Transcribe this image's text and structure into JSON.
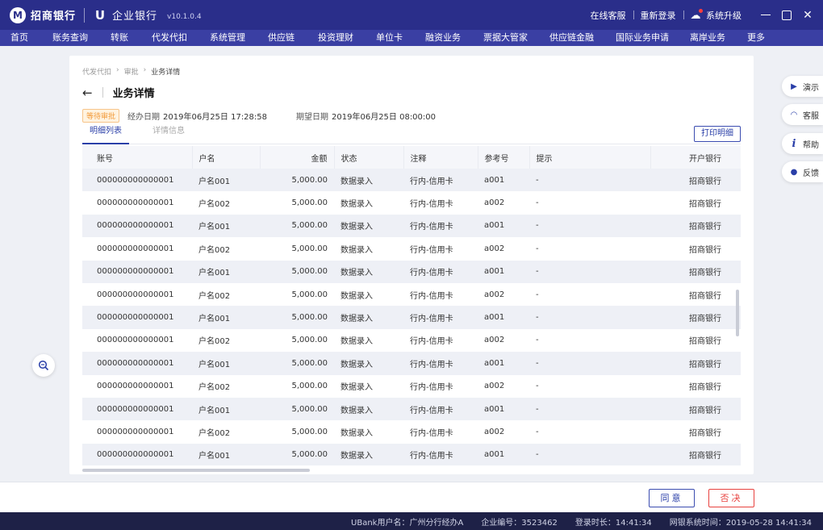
{
  "header": {
    "bank_logo_char": "M",
    "bank_name": "招商银行",
    "enterprise_logo_char": "U",
    "product_name": "企业银行",
    "version": "v10.1.0.4",
    "links": [
      "在线客服",
      "重新登录"
    ],
    "upgrade_label": "系统升级"
  },
  "nav": {
    "items": [
      "首页",
      "账务查询",
      "转账",
      "代发代扣",
      "系统管理",
      "供应链",
      "投资理财",
      "单位卡",
      "融资业务",
      "票据大管家",
      "供应链金融",
      "国际业务申请",
      "离岸业务",
      "更多"
    ]
  },
  "breadcrumb": [
    "代发代扣",
    "审批",
    "业务详情"
  ],
  "page": {
    "back_icon": "←",
    "title": "业务详情",
    "status_badge": "等待审批",
    "handle_date_label": "经办日期",
    "handle_date": "2019年06月25日 17:28:58",
    "expect_date_label": "期望日期",
    "expect_date": "2019年06月25日 08:00:00",
    "tabs": [
      "明细列表",
      "详情信息"
    ],
    "print_label": "打印明细"
  },
  "table": {
    "columns": [
      "账号",
      "户名",
      "金额",
      "状态",
      "注释",
      "参考号",
      "提示",
      "开户银行"
    ],
    "rows": [
      [
        "000000000000001",
        "户名001",
        "5,000.00",
        "数据录入",
        "行内-信用卡",
        "a001",
        "-",
        "招商银行"
      ],
      [
        "000000000000001",
        "户名002",
        "5,000.00",
        "数据录入",
        "行内-信用卡",
        "a002",
        "-",
        "招商银行"
      ],
      [
        "000000000000001",
        "户名001",
        "5,000.00",
        "数据录入",
        "行内-信用卡",
        "a001",
        "-",
        "招商银行"
      ],
      [
        "000000000000001",
        "户名002",
        "5,000.00",
        "数据录入",
        "行内-信用卡",
        "a002",
        "-",
        "招商银行"
      ],
      [
        "000000000000001",
        "户名001",
        "5,000.00",
        "数据录入",
        "行内-信用卡",
        "a001",
        "-",
        "招商银行"
      ],
      [
        "000000000000001",
        "户名002",
        "5,000.00",
        "数据录入",
        "行内-信用卡",
        "a002",
        "-",
        "招商银行"
      ],
      [
        "000000000000001",
        "户名001",
        "5,000.00",
        "数据录入",
        "行内-信用卡",
        "a001",
        "-",
        "招商银行"
      ],
      [
        "000000000000001",
        "户名002",
        "5,000.00",
        "数据录入",
        "行内-信用卡",
        "a002",
        "-",
        "招商银行"
      ],
      [
        "000000000000001",
        "户名001",
        "5,000.00",
        "数据录入",
        "行内-信用卡",
        "a001",
        "-",
        "招商银行"
      ],
      [
        "000000000000001",
        "户名002",
        "5,000.00",
        "数据录入",
        "行内-信用卡",
        "a002",
        "-",
        "招商银行"
      ],
      [
        "000000000000001",
        "户名001",
        "5,000.00",
        "数据录入",
        "行内-信用卡",
        "a001",
        "-",
        "招商银行"
      ],
      [
        "000000000000001",
        "户名002",
        "5,000.00",
        "数据录入",
        "行内-信用卡",
        "a002",
        "-",
        "招商银行"
      ],
      [
        "000000000000001",
        "户名001",
        "5,000.00",
        "数据录入",
        "行内-信用卡",
        "a001",
        "-",
        "招商银行"
      ]
    ]
  },
  "side_tools": [
    {
      "icon": "play-icon",
      "glyph": "▶",
      "label": "演示"
    },
    {
      "icon": "headset-icon",
      "glyph": "◠",
      "label": "客服"
    },
    {
      "icon": "info-icon",
      "glyph": "i",
      "label": "帮助"
    },
    {
      "icon": "chat-icon",
      "glyph": "●",
      "label": "反馈"
    }
  ],
  "actions": {
    "agree": "同意",
    "reject": "否决"
  },
  "status": {
    "user": "UBank用户名：广州分行经办A",
    "company": "企业编号：3523462",
    "login_time": "登录时长：14:41:34",
    "system_time": "网银系统时间：2019-05-28 14:41:34"
  },
  "colors": {
    "header_bg": "#2a2e8a",
    "nav_bg": "#3a3fa3",
    "accent": "#2a3fa8",
    "reject": "#e8423f",
    "badge": "#f29b3a"
  }
}
